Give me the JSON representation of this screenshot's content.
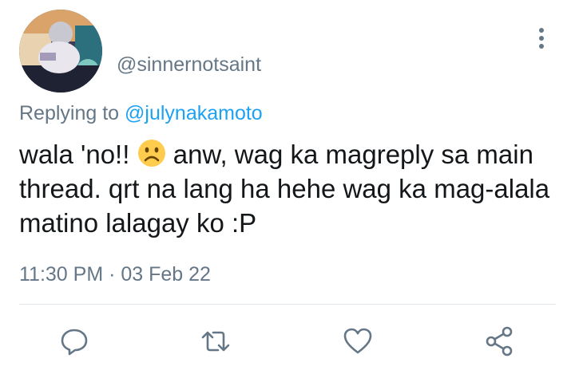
{
  "tweet": {
    "author_handle": "@sinnernotsaint",
    "replying_prefix": "Replying to",
    "replying_to_handle": "@julynakamoto",
    "text_before_emoji": "wala 'no!! ",
    "emoji": "frowning-face-icon",
    "text_after_emoji": " anw, wag ka magreply sa main thread. qrt na lang ha hehe wag ka mag-alala matino lalagay ko :P",
    "time": "11:30 PM",
    "date_separator": " · ",
    "date": "03 Feb 22"
  },
  "actions": [
    {
      "name": "reply",
      "icon": "comment-icon"
    },
    {
      "name": "retweet",
      "icon": "retweet-icon"
    },
    {
      "name": "like",
      "icon": "heart-icon"
    },
    {
      "name": "share",
      "icon": "share-icon"
    }
  ],
  "colors": {
    "text": "#14171a",
    "secondary": "#657786",
    "link": "#1da1f2",
    "divider": "#e1e8ed",
    "emoji": "#ffcc4d"
  }
}
